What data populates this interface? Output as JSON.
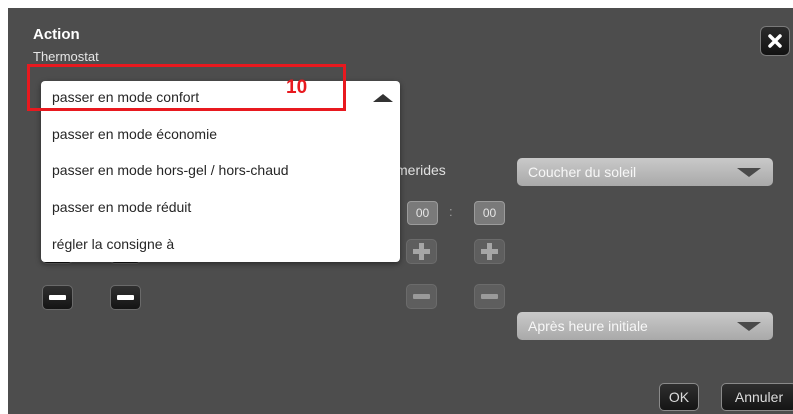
{
  "dialog": {
    "title": "Action",
    "subtitle": "Thermostat",
    "close_icon": "close-x-icon"
  },
  "action_dropdown": {
    "selected": "passer en mode confort",
    "options": [
      "passer en mode confort",
      "passer en mode économie",
      "passer en mode hors-gel / hors-chaud",
      "passer en mode réduit",
      "régler la consigne à"
    ],
    "arrow_icon": "caret-up-icon"
  },
  "ephemerides": {
    "label_visible": "merides",
    "selected": "Coucher du soleil",
    "hour": "00",
    "separator": ":",
    "minute": "00"
  },
  "offset": {
    "selected": "Après heure initiale"
  },
  "footer": {
    "ok_label": "OK",
    "cancel_label": "Annuler"
  },
  "annotation": {
    "step_number": "10",
    "color": "#e8191f"
  }
}
